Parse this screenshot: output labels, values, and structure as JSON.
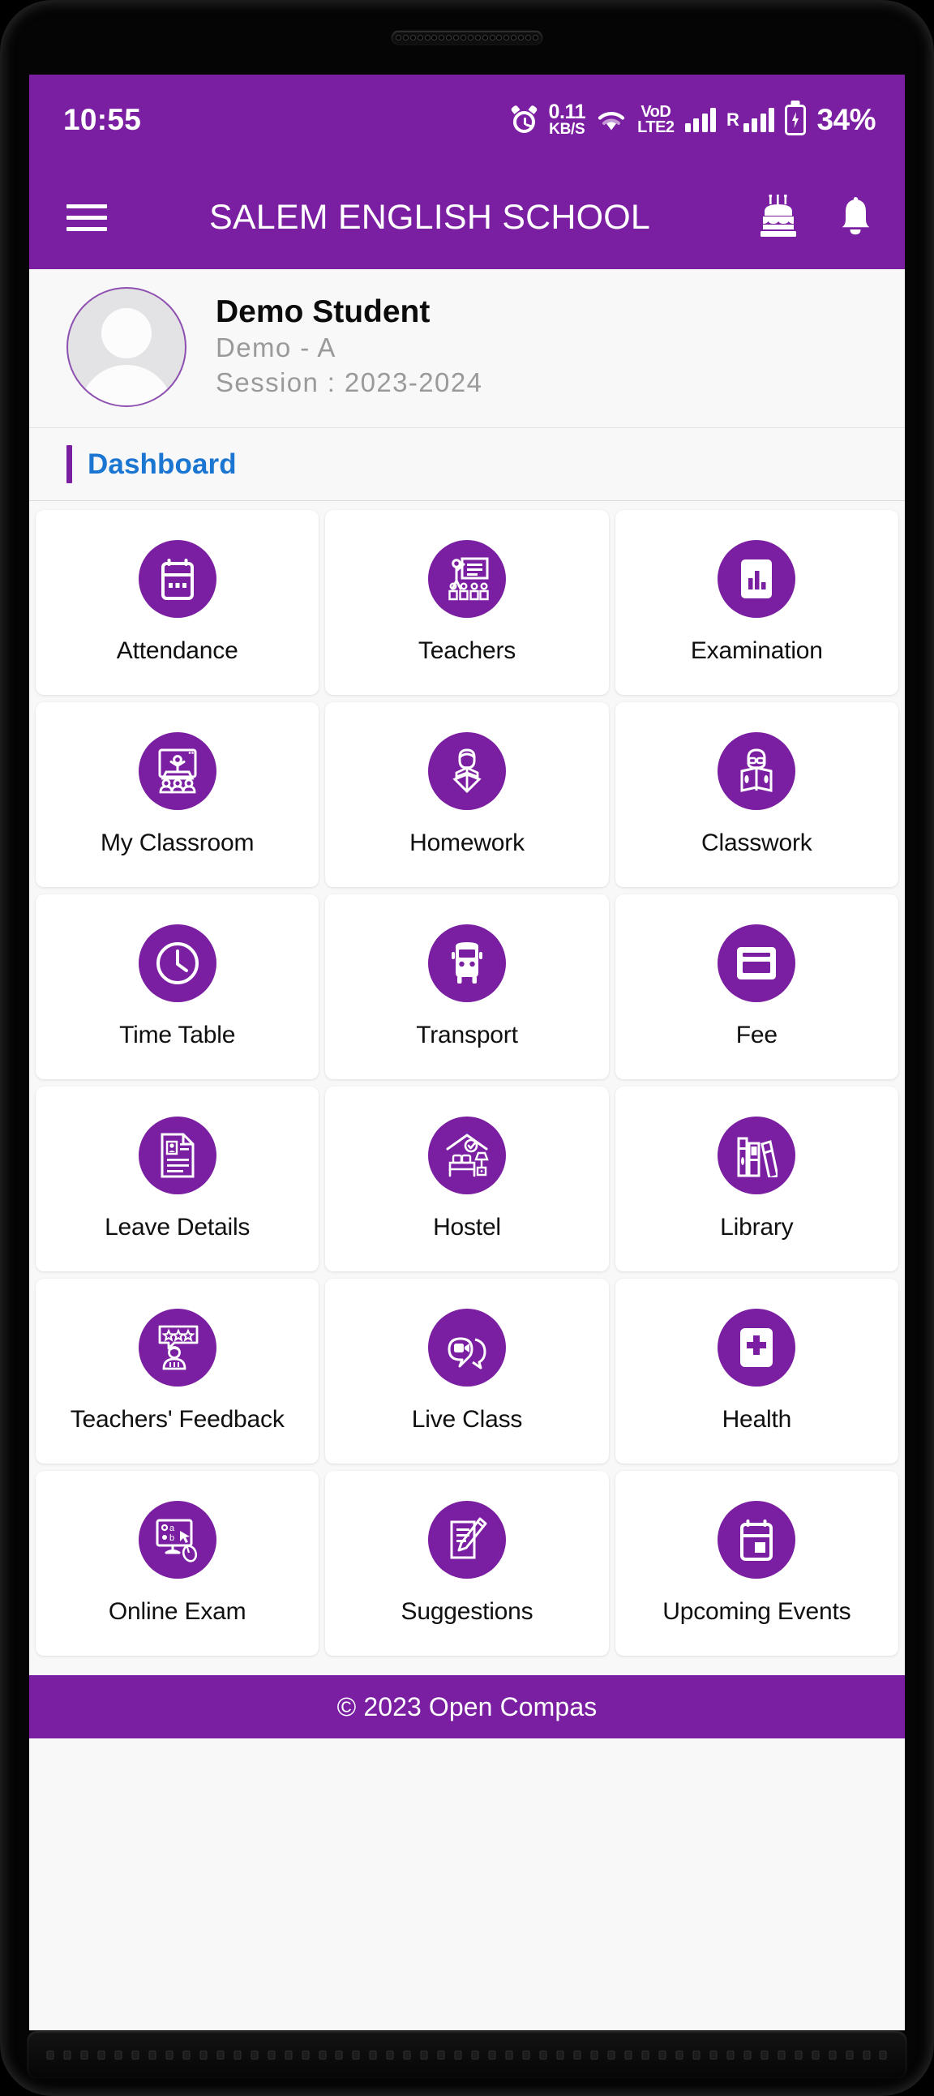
{
  "statusbar": {
    "time": "10:55",
    "netspeed_value": "0.11",
    "netspeed_unit": "KB/S",
    "volte_top": "VoD",
    "volte_bottom": "LTE2",
    "roaming_label": "R",
    "battery_percent": "34%",
    "icons": [
      "alarm-icon",
      "wifi-icon",
      "volte-icon",
      "signal-bars-icon",
      "roaming-signal-icon",
      "battery-charging-icon"
    ]
  },
  "appbar": {
    "menu_icon": "hamburger-menu-icon",
    "title": "SALEM ENGLISH SCHOOL",
    "cake_icon": "birthday-cake-icon",
    "bell_icon": "notification-bell-icon"
  },
  "profile": {
    "name": "Demo Student",
    "class": "Demo - A",
    "session": "Session : 2023-2024",
    "avatar_icon": "default-avatar-icon"
  },
  "section": {
    "title": "Dashboard"
  },
  "grid": {
    "tiles": [
      {
        "label": "Attendance",
        "icon": "calendar-icon"
      },
      {
        "label": "Teachers",
        "icon": "teacher-board-icon"
      },
      {
        "label": "Examination",
        "icon": "exam-chart-icon"
      },
      {
        "label": "My Classroom",
        "icon": "classroom-presentation-icon"
      },
      {
        "label": "Homework",
        "icon": "student-reading-icon"
      },
      {
        "label": "Classwork",
        "icon": "open-book-reader-icon"
      },
      {
        "label": "Time Table",
        "icon": "clock-icon"
      },
      {
        "label": "Transport",
        "icon": "bus-icon"
      },
      {
        "label": "Fee",
        "icon": "credit-card-icon"
      },
      {
        "label": "Leave Details",
        "icon": "document-profile-icon"
      },
      {
        "label": "Hostel",
        "icon": "hostel-bed-icon"
      },
      {
        "label": "Library",
        "icon": "books-shelf-icon"
      },
      {
        "label": "Teachers' Feedback",
        "icon": "star-rating-feedback-icon"
      },
      {
        "label": "Live Class",
        "icon": "video-chat-icon"
      },
      {
        "label": "Health",
        "icon": "medical-cross-icon"
      },
      {
        "label": "Online Exam",
        "icon": "monitor-mouse-icon"
      },
      {
        "label": "Suggestions",
        "icon": "pencil-note-icon"
      },
      {
        "label": "Upcoming Events",
        "icon": "events-calendar-icon"
      }
    ]
  },
  "footer": {
    "copyright": "© 2023 Open Compas"
  },
  "colors": {
    "brand_purple": "#7B1FA2",
    "accent_blue": "#1B76D2",
    "page_background": "#F8F8F9",
    "tile_background": "#FFFFFF"
  }
}
